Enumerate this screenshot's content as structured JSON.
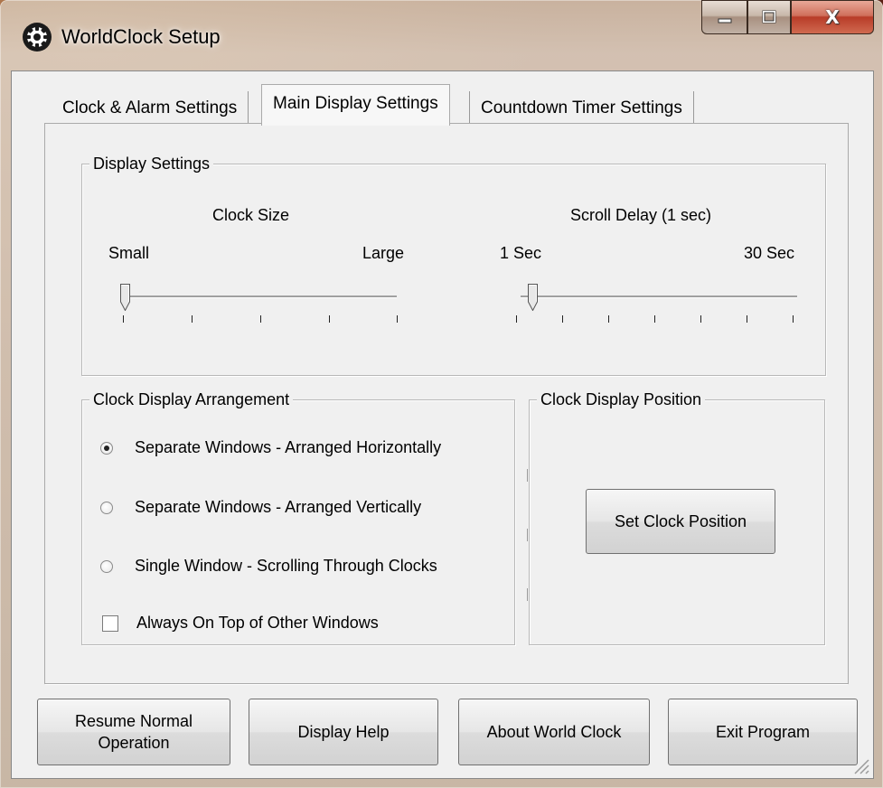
{
  "window": {
    "title": "WorldClock Setup",
    "icon": "gear-clock-icon"
  },
  "caption": {
    "minimize_icon": "minimize-icon",
    "maximize_icon": "maximize-icon",
    "close_label": "X"
  },
  "tabs": [
    {
      "label": "Clock & Alarm Settings",
      "active": false
    },
    {
      "label": "Main Display Settings",
      "active": true
    },
    {
      "label": "Countdown Timer Settings",
      "active": false
    }
  ],
  "display_settings": {
    "title": "Display Settings",
    "clock_size": {
      "label": "Clock Size",
      "min_label": "Small",
      "max_label": "Large",
      "value": 0,
      "tick_count": 5
    },
    "scroll_delay": {
      "label": "Scroll Delay (1 sec)",
      "min_label": "1 Sec",
      "max_label": "30 Sec",
      "value": 1,
      "tick_count": 7
    }
  },
  "arrangement": {
    "title": "Clock Display Arrangement",
    "options": [
      {
        "label": "Separate Windows - Arranged Horizontally",
        "checked": true
      },
      {
        "label": "Separate Windows - Arranged Vertically",
        "checked": false
      },
      {
        "label": "Single Window - Scrolling Through Clocks",
        "checked": false
      }
    ],
    "always_on_top": {
      "label": "Always On Top of Other Windows",
      "checked": false
    }
  },
  "position": {
    "title": "Clock Display Position",
    "button_label": "Set Clock Position"
  },
  "footer": {
    "resume_line1": "Resume Normal",
    "resume_line2": "Operation",
    "help_label": "Display Help",
    "about_label": "About World Clock",
    "exit_label": "Exit Program"
  }
}
